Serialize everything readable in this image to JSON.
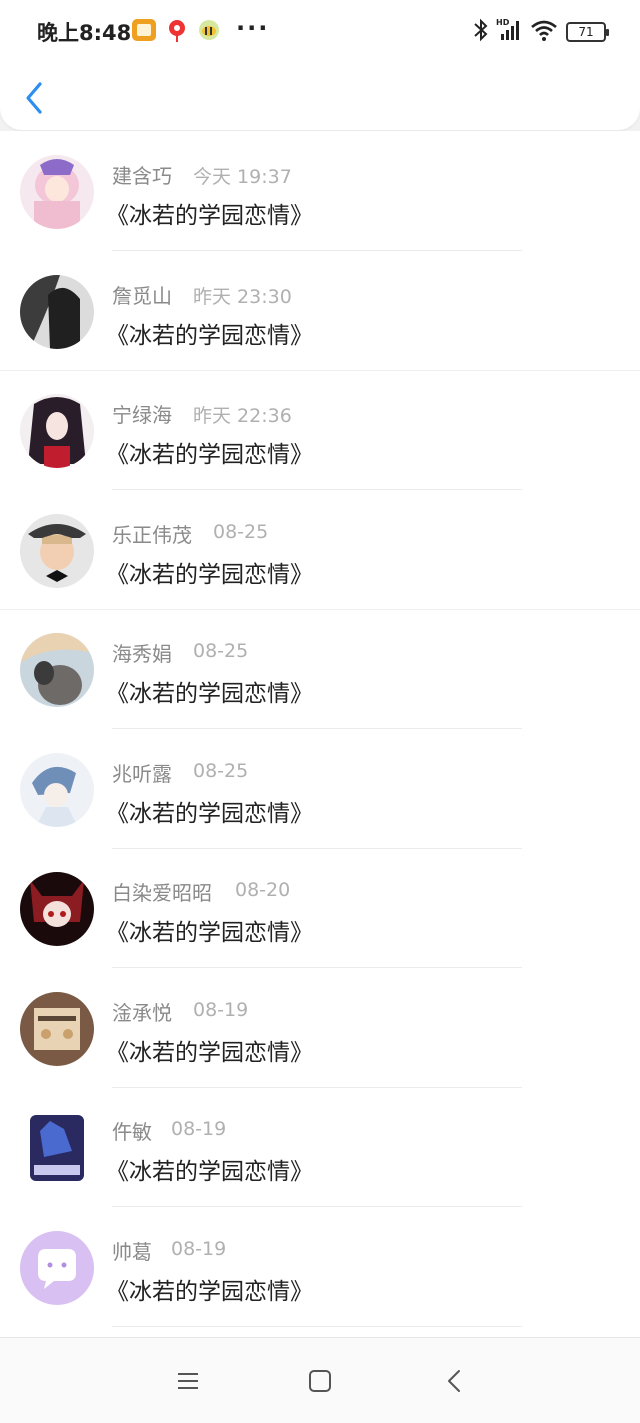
{
  "status_bar": {
    "time": "晚上8:48",
    "notifications": [
      "memo-icon",
      "map-pin-icon",
      "bee-icon"
    ],
    "more": "···",
    "battery": "71",
    "signal_label": "HD"
  },
  "header": {
    "back_icon": "chevron-left-icon"
  },
  "list": [
    {
      "name": "建含巧",
      "time": "今天 19:37",
      "message": "《冰若的学园恋情》",
      "avatar_color": "#e9c6d6"
    },
    {
      "name": "詹觅山",
      "time": "昨天 23:30",
      "message": "《冰若的学园恋情》",
      "avatar_color": "#6e6e6e"
    },
    {
      "name": "宁绿海",
      "time": "昨天 22:36",
      "message": "《冰若的学园恋情》",
      "avatar_color": "#2a2230"
    },
    {
      "name": "乐正伟茂",
      "time": "08-25",
      "message": "《冰若的学园恋情》",
      "avatar_color": "#c8b49c"
    },
    {
      "name": "海秀娟",
      "time": "08-25",
      "message": "《冰若的学园恋情》",
      "avatar_color": "#9aa4a8"
    },
    {
      "name": "兆听露",
      "time": "08-25",
      "message": "《冰若的学园恋情》",
      "avatar_color": "#b9c8de"
    },
    {
      "name": "白染爱昭昭",
      "time": "08-20",
      "message": "《冰若的学园恋情》",
      "avatar_color": "#3a1418"
    },
    {
      "name": "淦承悦",
      "time": "08-19",
      "message": "《冰若的学园恋情》",
      "avatar_color": "#8a6a50"
    },
    {
      "name": "仵敏",
      "time": "08-19",
      "message": "《冰若的学园恋情》",
      "avatar_color": "#2a2a5a"
    },
    {
      "name": "帅葛",
      "time": "08-19",
      "message": "《冰若的学园恋情》",
      "avatar_color": "#d4b9f0"
    }
  ],
  "nav": {
    "menu_icon": "menu-icon",
    "home_icon": "home-square-icon",
    "back_icon": "back-triangle-icon"
  },
  "colors": {
    "accent": "#2b8ef0",
    "name": "#8a8a8a",
    "time": "#b0b0b0"
  }
}
